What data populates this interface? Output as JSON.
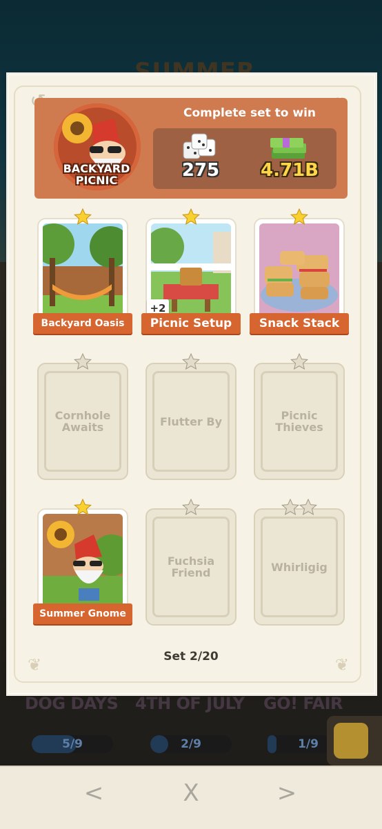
{
  "background": {
    "album_title": "SUMMER",
    "albums": [
      {
        "name": "DOG DAYS",
        "progress": "5/9",
        "fraction": 0.55
      },
      {
        "name": "4TH OF JULY",
        "progress": "2/9",
        "fraction": 0.22
      },
      {
        "name": "GO! FAIR",
        "progress": "1/9",
        "fraction": 0.11
      }
    ]
  },
  "header": {
    "title": "Complete set to win",
    "set_logo": "BACKYARD PICNIC",
    "reward_dice": "275",
    "reward_cash": "4.71B"
  },
  "cards": [
    {
      "name": "Backyard Oasis",
      "owned": true,
      "stars": 1
    },
    {
      "name": "Picnic Setup",
      "owned": true,
      "stars": 1,
      "extra": "+2"
    },
    {
      "name": "Snack Stack",
      "owned": true,
      "stars": 1
    },
    {
      "name": "Cornhole Awaits",
      "owned": false,
      "stars": 1
    },
    {
      "name": "Flutter By",
      "owned": false,
      "stars": 1
    },
    {
      "name": "Picnic Thieves",
      "owned": false,
      "stars": 1
    },
    {
      "name": "Summer Gnome",
      "owned": true,
      "stars": 1
    },
    {
      "name": "Fuchsia Friend",
      "owned": false,
      "stars": 1
    },
    {
      "name": "Whirligig",
      "owned": false,
      "stars": 2
    }
  ],
  "footer": {
    "set_progress": "Set 2/20"
  },
  "nav": {
    "prev": "<",
    "close": "X",
    "next": ">"
  },
  "colors": {
    "accent": "#d6652f",
    "header": "#cf7a4f",
    "panel": "#f6f2e6"
  }
}
